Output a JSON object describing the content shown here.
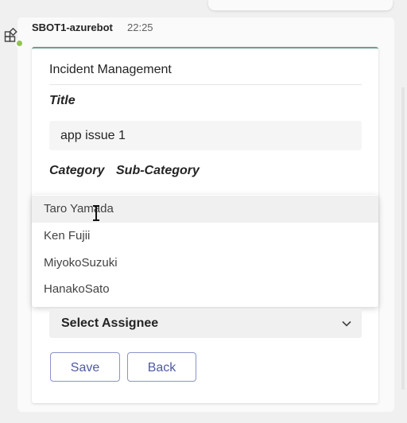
{
  "message": {
    "sender": "SBOT1-azurebot",
    "time": "22:25"
  },
  "card": {
    "title": "Incident Management",
    "fields": {
      "title_label": "Title",
      "title_value": "app issue 1",
      "category_label": "Category",
      "subcategory_label": "Sub-Category"
    },
    "dropdown_options": [
      "Taro Yamada",
      "Ken Fujii",
      "MiyokoSuzuki",
      "HanakoSato"
    ],
    "assignee_select": "Select Assignee",
    "save_label": "Save",
    "back_label": "Back"
  },
  "icons": {
    "bot": "bot-app-icon",
    "presence": "presence-available-icon",
    "chevron": "chevron-down-icon",
    "cursor": "text-cursor-icon"
  },
  "colors": {
    "accent": "#6c9e8d",
    "button_text": "#4f5aa0",
    "button_border": "#8a94c9",
    "presence": "#92c353"
  }
}
